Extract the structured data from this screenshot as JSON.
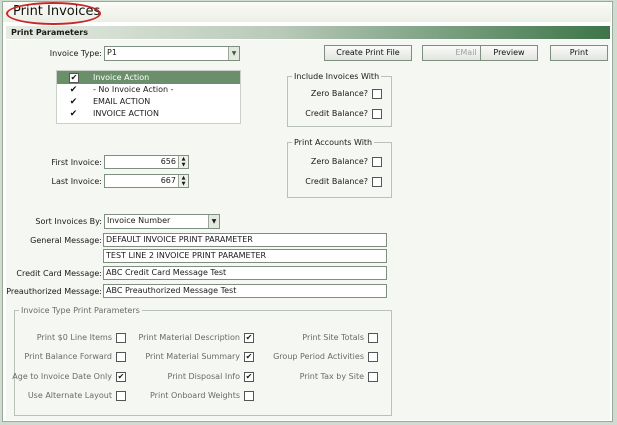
{
  "title": "Print Invoices",
  "section": "Print Parameters",
  "invoice_type": {
    "label": "Invoice Type:",
    "value": "P1"
  },
  "buttons": {
    "create_file": "Create Print File",
    "email": "EMail",
    "preview": "Preview",
    "print": "Print"
  },
  "invoice_action": {
    "header": "Invoice Action",
    "items": [
      {
        "label": "- No Invoice Action -",
        "checked": true
      },
      {
        "label": "EMAIL ACTION",
        "checked": true
      },
      {
        "label": "INVOICE ACTION",
        "checked": true
      }
    ]
  },
  "include_invoices": {
    "legend": "Include Invoices With",
    "zero": "Zero Balance?",
    "credit": "Credit Balance?"
  },
  "print_accounts": {
    "legend": "Print Accounts With",
    "zero": "Zero Balance?",
    "credit": "Credit Balance?"
  },
  "first_invoice": {
    "label": "First Invoice:",
    "value": "656"
  },
  "last_invoice": {
    "label": "Last Invoice:",
    "value": "667"
  },
  "sort_by": {
    "label": "Sort Invoices By:",
    "value": "Invoice Number"
  },
  "general_message": {
    "label": "General Message:",
    "line1": "DEFAULT INVOICE PRINT PARAMETER",
    "line2": "TEST LINE 2 INVOICE PRINT PARAMETER"
  },
  "credit_card_message": {
    "label": "Credit Card Message:",
    "value": "ABC Credit Card Message Test"
  },
  "preauth_message": {
    "label": "Preauthorized Message:",
    "value": "ABC Preauthorized Message Test"
  },
  "type_params": {
    "legend": "Invoice Type Print Parameters",
    "col1": [
      {
        "label": "Print $0 Line Items",
        "checked": false
      },
      {
        "label": "Print Balance Forward",
        "checked": false
      },
      {
        "label": "Age to Invoice Date Only",
        "checked": true
      },
      {
        "label": "Use Alternate Layout",
        "checked": false
      }
    ],
    "col2": [
      {
        "label": "Print Material Description",
        "checked": true
      },
      {
        "label": "Print Material Summary",
        "checked": true
      },
      {
        "label": "Print Disposal Info",
        "checked": true
      },
      {
        "label": "Print Onboard Weights",
        "checked": false
      }
    ],
    "col3": [
      {
        "label": "Print Site Totals",
        "checked": false
      },
      {
        "label": "Group Period Activities",
        "checked": false
      },
      {
        "label": "Print Tax by Site",
        "checked": false
      }
    ]
  },
  "glyphs": {
    "check": "✔",
    "dropdown": "▼",
    "up": "▲",
    "down": "▼"
  },
  "colors": {
    "accent": "#3d7548",
    "list_header": "#6b8f6b",
    "highlight": "#c62828"
  }
}
